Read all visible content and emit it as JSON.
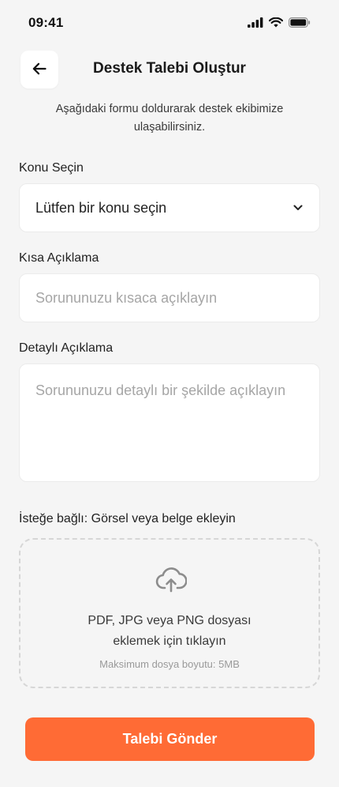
{
  "status_bar": {
    "time": "09:41",
    "icons": [
      "cellular-signal-icon",
      "wifi-icon",
      "battery-icon"
    ]
  },
  "header": {
    "back_icon": "arrow-left-icon",
    "title": "Destek Talebi Oluştur"
  },
  "intro": {
    "line1": "Aşağıdaki formu doldurarak destek ekibimize",
    "line2": "ulaşabilirsiniz."
  },
  "form": {
    "topic": {
      "label": "Konu Seçin",
      "selected": "Lütfen bir konu seçin",
      "icon": "chevron-down-icon"
    },
    "short_description": {
      "label": "Kısa Açıklama",
      "value": "",
      "placeholder": "Sorununuzu kısaca açıklayın"
    },
    "detailed_description": {
      "label": "Detaylı Açıklama",
      "value": "",
      "placeholder": "Sorununuzu detaylı bir şekilde açıklayın"
    },
    "attachment": {
      "label": "İsteğe bağlı: Görsel veya belge ekleyin",
      "icon": "cloud-upload-icon",
      "line1": "PDF, JPG veya PNG dosyası",
      "line2": "eklemek için tıklayın",
      "hint": "Maksimum dosya boyutu: 5MB"
    },
    "submit_label": "Talebi Gönder"
  },
  "colors": {
    "accent": "#ff6b35",
    "background": "#f5f5f5",
    "surface": "#ffffff",
    "placeholder": "#a6a6a6"
  }
}
